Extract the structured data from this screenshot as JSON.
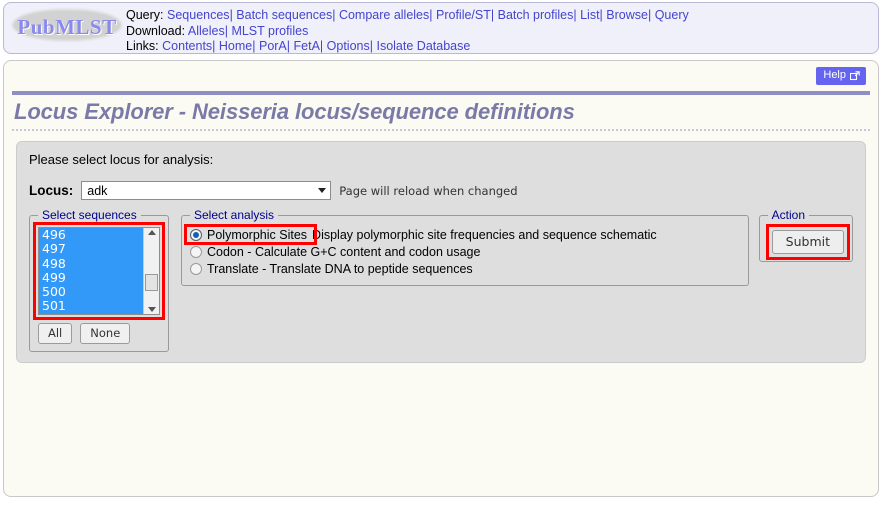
{
  "header": {
    "logo_text": "PubMLST",
    "rows": [
      {
        "label": "Query:",
        "links": [
          "Sequences",
          "Batch sequences",
          "Compare alleles",
          "Profile/ST",
          "Batch profiles",
          "List",
          "Browse",
          "Query"
        ]
      },
      {
        "label": "Download:",
        "links": [
          "Alleles",
          "MLST profiles"
        ]
      },
      {
        "label": "Links:",
        "links": [
          "Contents",
          "Home",
          "PorA",
          "FetA",
          "Options",
          "Isolate Database"
        ]
      }
    ],
    "separator": "|"
  },
  "help": {
    "label": "Help",
    "icon": "external-link-icon"
  },
  "page": {
    "title": "Locus Explorer - Neisseria locus/sequence definitions"
  },
  "form": {
    "intro": "Please select locus for analysis:",
    "locus_label": "Locus:",
    "locus_value": "adk",
    "locus_options": [
      "adk"
    ],
    "reload_hint": "Page will reload when changed"
  },
  "sequences": {
    "legend": "Select sequences",
    "items": [
      "496",
      "497",
      "498",
      "499",
      "500",
      "501"
    ],
    "buttons": [
      "All",
      "None"
    ],
    "scrollbar": {
      "up_icon": "triangle-up-icon",
      "down_icon": "triangle-down-icon"
    }
  },
  "analysis": {
    "legend": "Select analysis",
    "options": [
      {
        "label": "Polymorphic Sites",
        "description": "Display polymorphic site frequencies and sequence schematic",
        "checked": true
      },
      {
        "label": "Codon - Calculate G+C content and codon usage",
        "description": "",
        "checked": false
      },
      {
        "label": "Translate - Translate DNA to peptide sequences",
        "description": "",
        "checked": false
      }
    ]
  },
  "action": {
    "legend": "Action",
    "submit_label": "Submit"
  },
  "colors": {
    "annotation": "#ff0000",
    "selection": "#3399f9",
    "link": "#4444cc",
    "legend": "#00008b",
    "help_button": "#6464f0",
    "title": "#7a7aa8"
  }
}
